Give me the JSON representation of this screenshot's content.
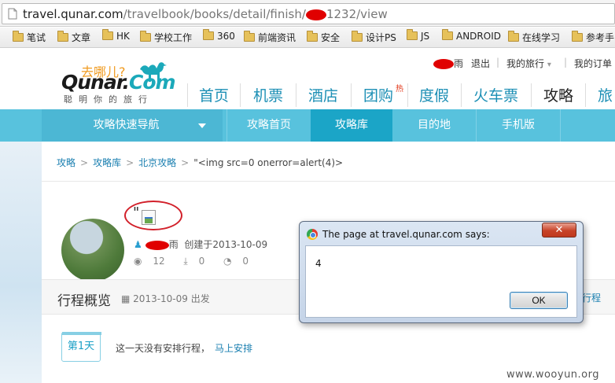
{
  "address_bar": {
    "host": "travel.qunar.com",
    "path_before": "/travelbook/books/detail/finish/",
    "path_after": "1232/view"
  },
  "bookmarks": [
    "笔试",
    "文章",
    "HK",
    "学校工作",
    "360",
    "前端资讯",
    "安全",
    "设计PS",
    "JS",
    "ANDROID",
    "在线学习",
    "参考手"
  ],
  "site": {
    "logo_tagline": "去哪儿?",
    "logo_name_a": "Qunar.",
    "logo_name_b": "Com",
    "logo_sub": "聪明你的旅行",
    "user_suffix": "雨",
    "logout": "退出",
    "my_trips": "我的旅行",
    "my_orders": "我的订单",
    "nav": [
      "首页",
      "机票",
      "酒店",
      "团购",
      "度假",
      "火车票",
      "攻略",
      "旅"
    ],
    "nav_hot_badge": "热",
    "subnav": [
      "攻略快速导航",
      "攻略首页",
      "攻略库",
      "目的地",
      "手机版"
    ]
  },
  "breadcrumb": {
    "items": [
      "攻略",
      "攻略库",
      "北京攻略"
    ],
    "sep": ">",
    "current": "\"<img src=0 onerror=alert(4)>"
  },
  "book": {
    "title_quote": "\"",
    "author_suffix": "雨",
    "created": "创建于2013-10-09",
    "views": "12",
    "downloads": "0",
    "comments": "0"
  },
  "overview": {
    "title": "行程概览",
    "date": "2013-10-09",
    "date_suffix": "出发",
    "link": "行程"
  },
  "day": {
    "badge": "第1天",
    "empty_text": "这一天没有安排行程，",
    "action": "马上安排"
  },
  "dialog": {
    "title": "The page at travel.qunar.com says:",
    "message": "4",
    "ok": "OK",
    "close": "✕"
  },
  "watermark": "www.wooyun.org"
}
